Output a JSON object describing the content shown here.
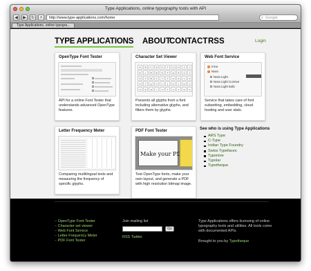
{
  "browser": {
    "window_title": "Type Applications, online typography tools with API",
    "url": "http://www.type-applications.com/home",
    "search_placeholder": "Google",
    "tab_title": "Type Applications, online typogra..."
  },
  "header": {
    "logo": "TYPE APPLICATIONS",
    "nav": [
      "ABOUT",
      "CONTACT",
      "RSS"
    ],
    "login": "Login"
  },
  "cards": [
    {
      "title": "OpenType Font Tester",
      "desc": "API for a online Font Tester that understands advanced OpenType features."
    },
    {
      "title": "Character Set Viewer",
      "desc": "Presents all glyphs from a font including alternative glyphs, and filters them by glyphs."
    },
    {
      "title": "Web Font Service",
      "desc": "Service that takes care of font subsetting, embedding, cloud hosting and user stats."
    },
    {
      "title": "Letter Frequency Meter",
      "desc": "Comparing multilingual texts and measuring the frequency of specific glyphs."
    },
    {
      "title": "PDF Font Tester",
      "desc": "Test OpenType fonts, make your own layout, and generate a PDF with high resolution bitmap image."
    }
  ],
  "glyphs": [
    "A",
    "B",
    "C",
    "D",
    "E",
    "F",
    "G",
    "H",
    "I",
    "J",
    "K",
    "L",
    "M",
    "N",
    "O",
    "P",
    "Q",
    "R",
    "S",
    "T",
    "U",
    "V",
    "W",
    "X",
    "Y",
    "Z",
    "a",
    "b",
    "c",
    "d",
    "e",
    "f",
    "g",
    "h",
    "i",
    "j",
    "k",
    "l",
    "m",
    "n",
    "o",
    "p",
    "q",
    "r",
    "s",
    "t",
    "u",
    "v",
    "w",
    "x"
  ],
  "webfont": {
    "family1": "Irma",
    "family2": "Nara",
    "styles": [
      "Nara Light",
      "Nara Light Cursive",
      "Nara Light Italic"
    ]
  },
  "pdf_sample": "Make your PDF",
  "sidebar": {
    "title": "See who is using Type Applications",
    "items": [
      "ARS Type",
      "C-Type",
      "Indian Type Foundry",
      "Swiss Typefaces",
      "Typonine",
      "Typolar",
      "Typotheque"
    ]
  },
  "footer": {
    "links": [
      "Character set viewer",
      "Web Font Service",
      "Letter Frequency Meter",
      "PDF Font Tester"
    ],
    "first_link": "OpenType Font Tester",
    "mailing_label": "Join mailing list",
    "go_label": "Go",
    "rss_twitter": "RSS Twitter",
    "about": "Type Applications offers licensing of online typography tools and utilities. All tools come with documented APIs.",
    "brought_by": "Brought to you by",
    "brought_link": "Typotheque"
  },
  "colors": {
    "accent": "#76c442",
    "link": "#2a5e0f",
    "footer_link": "#9dd46d"
  }
}
